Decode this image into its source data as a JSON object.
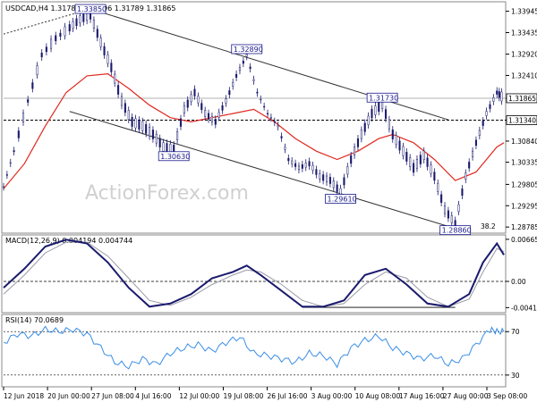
{
  "chart_data": {
    "type": "candlestick",
    "symbol_line": "USDCAD,H4  1.31789 1.31896 1.31789 1.31865",
    "watermark": "ActionForex.com",
    "price_axis": [
      1.33945,
      1.33435,
      1.3292,
      1.3241,
      1.31865,
      1.3134,
      1.3084,
      1.30335,
      1.29805,
      1.29295,
      1.28785
    ],
    "price_ylim": [
      1.2866,
      1.3415
    ],
    "fib_label": "38.2",
    "last_price": "1.31865",
    "reference_price": "1.31340",
    "x_labels": [
      "12 Jun 2018",
      "20 Jun 00:00",
      "27 Jun 08:00",
      "4 Jul 16:00",
      "12 Jul 00:00",
      "19 Jul 08:00",
      "26 Jul 16:00",
      "3 Aug 00:00",
      "10 Aug 08:00",
      "17 Aug 16:00",
      "27 Aug 00:00",
      "3 Sep 08:00"
    ],
    "price_path": [
      [
        0,
        1.2975
      ],
      [
        3,
        1.306
      ],
      [
        7,
        1.318
      ],
      [
        11,
        1.329
      ],
      [
        15,
        1.333
      ],
      [
        19,
        1.3355
      ],
      [
        22,
        1.3375
      ],
      [
        25,
        1.3385
      ],
      [
        28,
        1.332
      ],
      [
        31,
        1.326
      ],
      [
        34,
        1.318
      ],
      [
        37,
        1.313
      ],
      [
        40,
        1.312
      ],
      [
        43,
        1.31
      ],
      [
        46,
        1.307
      ],
      [
        49,
        1.3065
      ],
      [
        52,
        1.316
      ],
      [
        55,
        1.32
      ],
      [
        58,
        1.315
      ],
      [
        61,
        1.313
      ],
      [
        64,
        1.318
      ],
      [
        67,
        1.324
      ],
      [
        70,
        1.3289
      ],
      [
        73,
        1.32
      ],
      [
        76,
        1.315
      ],
      [
        79,
        1.312
      ],
      [
        82,
        1.304
      ],
      [
        85,
        1.302
      ],
      [
        88,
        1.303
      ],
      [
        91,
        1.3
      ],
      [
        94,
        1.299
      ],
      [
        97,
        1.2962
      ],
      [
        100,
        1.304
      ],
      [
        103,
        1.31
      ],
      [
        106,
        1.315
      ],
      [
        109,
        1.3173
      ],
      [
        112,
        1.31
      ],
      [
        115,
        1.306
      ],
      [
        118,
        1.302
      ],
      [
        121,
        1.305
      ],
      [
        124,
        1.3
      ],
      [
        127,
        1.292
      ],
      [
        130,
        1.2886
      ],
      [
        133,
        1.3
      ],
      [
        136,
        1.308
      ],
      [
        139,
        1.315
      ],
      [
        142,
        1.32
      ],
      [
        144,
        1.3186
      ]
    ],
    "ma_path": [
      [
        0,
        1.297
      ],
      [
        6,
        1.303
      ],
      [
        12,
        1.312
      ],
      [
        18,
        1.32
      ],
      [
        24,
        1.324
      ],
      [
        30,
        1.3245
      ],
      [
        36,
        1.321
      ],
      [
        42,
        1.317
      ],
      [
        48,
        1.314
      ],
      [
        54,
        1.313
      ],
      [
        60,
        1.314
      ],
      [
        66,
        1.315
      ],
      [
        72,
        1.316
      ],
      [
        78,
        1.313
      ],
      [
        84,
        1.309
      ],
      [
        90,
        1.306
      ],
      [
        96,
        1.304
      ],
      [
        102,
        1.306
      ],
      [
        108,
        1.309
      ],
      [
        112,
        1.31
      ],
      [
        118,
        1.308
      ],
      [
        124,
        1.304
      ],
      [
        130,
        1.299
      ],
      [
        136,
        1.301
      ],
      [
        142,
        1.307
      ],
      [
        144,
        1.308
      ]
    ],
    "channel_upper": [
      [
        25,
        1.34
      ],
      [
        128,
        1.3135
      ]
    ],
    "channel_lower": [
      [
        19,
        1.3155
      ],
      [
        130,
        1.2875
      ]
    ],
    "trend_dotted": [
      [
        0,
        1.334
      ],
      [
        25,
        1.34
      ]
    ],
    "price_labels": [
      {
        "text": "1.33850",
        "x": 25,
        "y": 1.3385
      },
      {
        "text": "1.32890",
        "x": 70,
        "y": 1.3289
      },
      {
        "text": "1.30630",
        "x": 49,
        "y": 1.3063
      },
      {
        "text": "1.31730",
        "x": 109,
        "y": 1.3173
      },
      {
        "text": "1.29610",
        "x": 97,
        "y": 1.2961
      },
      {
        "text": "1.28860",
        "x": 130,
        "y": 1.2886
      }
    ],
    "macd": {
      "label": "MACD(12,26,9) 0.004194 0.004744",
      "axis": [
        "0.006651",
        "0.00",
        "-0.004145"
      ],
      "ylim": [
        -0.0048,
        0.0072
      ],
      "macd_path": [
        [
          0,
          -0.001
        ],
        [
          6,
          0.002
        ],
        [
          12,
          0.0055
        ],
        [
          18,
          0.0066
        ],
        [
          24,
          0.006
        ],
        [
          30,
          0.003
        ],
        [
          36,
          -0.001
        ],
        [
          42,
          -0.004
        ],
        [
          48,
          -0.0035
        ],
        [
          54,
          -0.002
        ],
        [
          60,
          0.0005
        ],
        [
          66,
          0.0015
        ],
        [
          70,
          0.0025
        ],
        [
          74,
          0.001
        ],
        [
          80,
          -0.0015
        ],
        [
          86,
          -0.004
        ],
        [
          92,
          -0.004
        ],
        [
          98,
          -0.003
        ],
        [
          104,
          0.001
        ],
        [
          110,
          0.002
        ],
        [
          116,
          -0.0005
        ],
        [
          122,
          -0.0035
        ],
        [
          128,
          -0.004
        ],
        [
          134,
          -0.002
        ],
        [
          138,
          0.003
        ],
        [
          142,
          0.006
        ],
        [
          144,
          0.0042
        ]
      ],
      "signal_path": [
        [
          0,
          -0.002
        ],
        [
          6,
          0.001
        ],
        [
          12,
          0.0045
        ],
        [
          18,
          0.0062
        ],
        [
          24,
          0.0062
        ],
        [
          30,
          0.004
        ],
        [
          36,
          0.0005
        ],
        [
          42,
          -0.003
        ],
        [
          48,
          -0.0038
        ],
        [
          54,
          -0.0025
        ],
        [
          60,
          -0.0005
        ],
        [
          66,
          0.001
        ],
        [
          70,
          0.0018
        ],
        [
          74,
          0.0015
        ],
        [
          80,
          -0.0005
        ],
        [
          86,
          -0.003
        ],
        [
          92,
          -0.004
        ],
        [
          98,
          -0.0035
        ],
        [
          104,
          -0.0005
        ],
        [
          110,
          0.0015
        ],
        [
          116,
          0.0005
        ],
        [
          122,
          -0.0025
        ],
        [
          128,
          -0.004
        ],
        [
          134,
          -0.0028
        ],
        [
          138,
          0.0015
        ],
        [
          142,
          0.0052
        ],
        [
          144,
          0.0047
        ]
      ],
      "baseline_segment": [
        [
          86,
          -0.0041
        ],
        [
          130,
          -0.0041
        ]
      ]
    },
    "rsi": {
      "label": "RSI(14) 70.0689",
      "axis": [
        "70",
        "30"
      ],
      "ylim": [
        20,
        85
      ],
      "levels": [
        70,
        30
      ],
      "rsi_path": [
        [
          0,
          60
        ],
        [
          4,
          68
        ],
        [
          8,
          66
        ],
        [
          12,
          72
        ],
        [
          16,
          70
        ],
        [
          20,
          72
        ],
        [
          24,
          68
        ],
        [
          28,
          55
        ],
        [
          32,
          42
        ],
        [
          36,
          38
        ],
        [
          40,
          45
        ],
        [
          44,
          40
        ],
        [
          48,
          50
        ],
        [
          52,
          55
        ],
        [
          56,
          58
        ],
        [
          60,
          52
        ],
        [
          64,
          60
        ],
        [
          68,
          65
        ],
        [
          72,
          50
        ],
        [
          76,
          48
        ],
        [
          80,
          45
        ],
        [
          84,
          42
        ],
        [
          88,
          50
        ],
        [
          92,
          48
        ],
        [
          96,
          40
        ],
        [
          100,
          55
        ],
        [
          104,
          62
        ],
        [
          108,
          66
        ],
        [
          112,
          55
        ],
        [
          116,
          50
        ],
        [
          120,
          45
        ],
        [
          124,
          48
        ],
        [
          128,
          40
        ],
        [
          132,
          45
        ],
        [
          136,
          58
        ],
        [
          140,
          72
        ],
        [
          142,
          70
        ],
        [
          144,
          70
        ]
      ]
    }
  }
}
